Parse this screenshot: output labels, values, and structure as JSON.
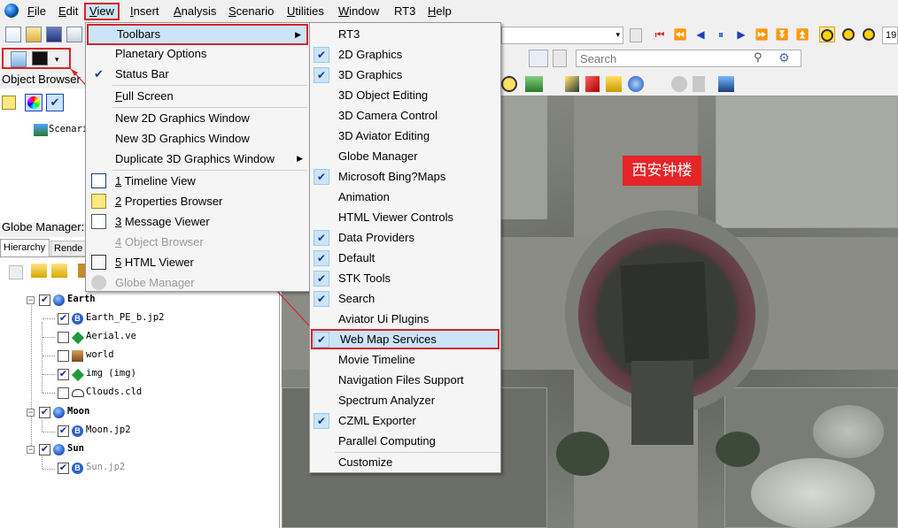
{
  "menubar": {
    "items": [
      {
        "label": "File",
        "underline": "F",
        "rest": "ile"
      },
      {
        "label": "Edit",
        "underline": "E",
        "rest": "dit"
      },
      {
        "label": "View",
        "underline": "V",
        "rest": "iew"
      },
      {
        "label": "Insert",
        "underline": "I",
        "rest": "nsert"
      },
      {
        "label": "Analysis",
        "underline": "A",
        "rest": "nalysis"
      },
      {
        "label": "Scenario",
        "underline": "S",
        "rest": "cenario"
      },
      {
        "label": "Utilities",
        "underline": "U",
        "rest": "tilities"
      },
      {
        "label": "Window",
        "underline": "W",
        "rest": "indow"
      },
      {
        "label": "RT3",
        "underline": "",
        "rest": "RT3"
      },
      {
        "label": "Help",
        "underline": "H",
        "rest": "elp"
      }
    ]
  },
  "toolbar": {
    "search_placeholder": "Search",
    "time_step_partial": "19"
  },
  "panels": {
    "object_browser_title": "Object Browser",
    "scenario_item": "Scenari",
    "globe_manager_title": "Globe Manager:",
    "tabs": [
      "Hierarchy",
      "Rende"
    ]
  },
  "tree": [
    {
      "label": "Earth",
      "bold": true
    },
    {
      "label": "Earth_PE_b.jp2"
    },
    {
      "label": "Aerial.ve"
    },
    {
      "label": "world"
    },
    {
      "label": "img (img)"
    },
    {
      "label": "Clouds.cld"
    },
    {
      "label": "Moon",
      "bold": true
    },
    {
      "label": "Moon.jp2"
    },
    {
      "label": "Sun",
      "bold": true
    },
    {
      "label": "Sun.jp2",
      "grey": true
    }
  ],
  "view_menu": {
    "items": [
      {
        "label": "Toolbars",
        "submenu": true
      },
      {
        "label": "Planetary Options"
      },
      {
        "label": "Status Bar",
        "checked": true
      },
      {
        "label": "Full Screen",
        "underline": "F",
        "rest": "ull Screen"
      },
      {
        "label": "New 2D Graphics Window"
      },
      {
        "label": "New 3D Graphics Window"
      },
      {
        "label": "Duplicate 3D Graphics Window",
        "submenu": true
      },
      {
        "label": "1 Timeline View",
        "num": "1",
        "rest": " Timeline View"
      },
      {
        "label": "2 Properties Browser",
        "num": "2",
        "rest": " Properties Browser"
      },
      {
        "label": "3 Message Viewer",
        "num": "3",
        "rest": " Message Viewer"
      },
      {
        "label": "4 Object Browser",
        "num": "4",
        "rest": " Object Browser",
        "disabled": true
      },
      {
        "label": "5 HTML Viewer",
        "num": "5",
        "rest": " HTML Viewer"
      },
      {
        "label": "Globe Manager",
        "disabled": true
      }
    ]
  },
  "toolbars_menu": {
    "items": [
      {
        "label": "RT3",
        "checked": false
      },
      {
        "label": "2D Graphics",
        "checked": true
      },
      {
        "label": "3D Graphics",
        "checked": true
      },
      {
        "label": "3D Object Editing",
        "checked": false
      },
      {
        "label": "3D Camera Control",
        "checked": false
      },
      {
        "label": "3D Aviator Editing",
        "checked": false
      },
      {
        "label": "Globe Manager",
        "checked": false
      },
      {
        "label": "Microsoft Bing?Maps",
        "checked": true
      },
      {
        "label": "Animation",
        "checked": false
      },
      {
        "label": "HTML Viewer Controls",
        "checked": false
      },
      {
        "label": "Data Providers",
        "checked": true
      },
      {
        "label": "Default",
        "checked": true
      },
      {
        "label": "STK Tools",
        "checked": true
      },
      {
        "label": "Search",
        "checked": true
      },
      {
        "label": "Aviator Ui Plugins",
        "checked": false
      },
      {
        "label": "Web Map Services",
        "checked": true
      },
      {
        "label": "Movie Timeline",
        "checked": false
      },
      {
        "label": "Navigation Files Support",
        "checked": false
      },
      {
        "label": "Spectrum Analyzer",
        "checked": false
      },
      {
        "label": "CZML Exporter",
        "checked": true
      },
      {
        "label": "Parallel Computing",
        "checked": false
      },
      {
        "label": "Customize",
        "checked": false
      }
    ]
  },
  "map": {
    "annotation": "西安钟楼"
  },
  "colors": {
    "highlight_border": "#d8232a",
    "menu_hover": "#cce4f7",
    "annotation_bg": "#e52528"
  }
}
